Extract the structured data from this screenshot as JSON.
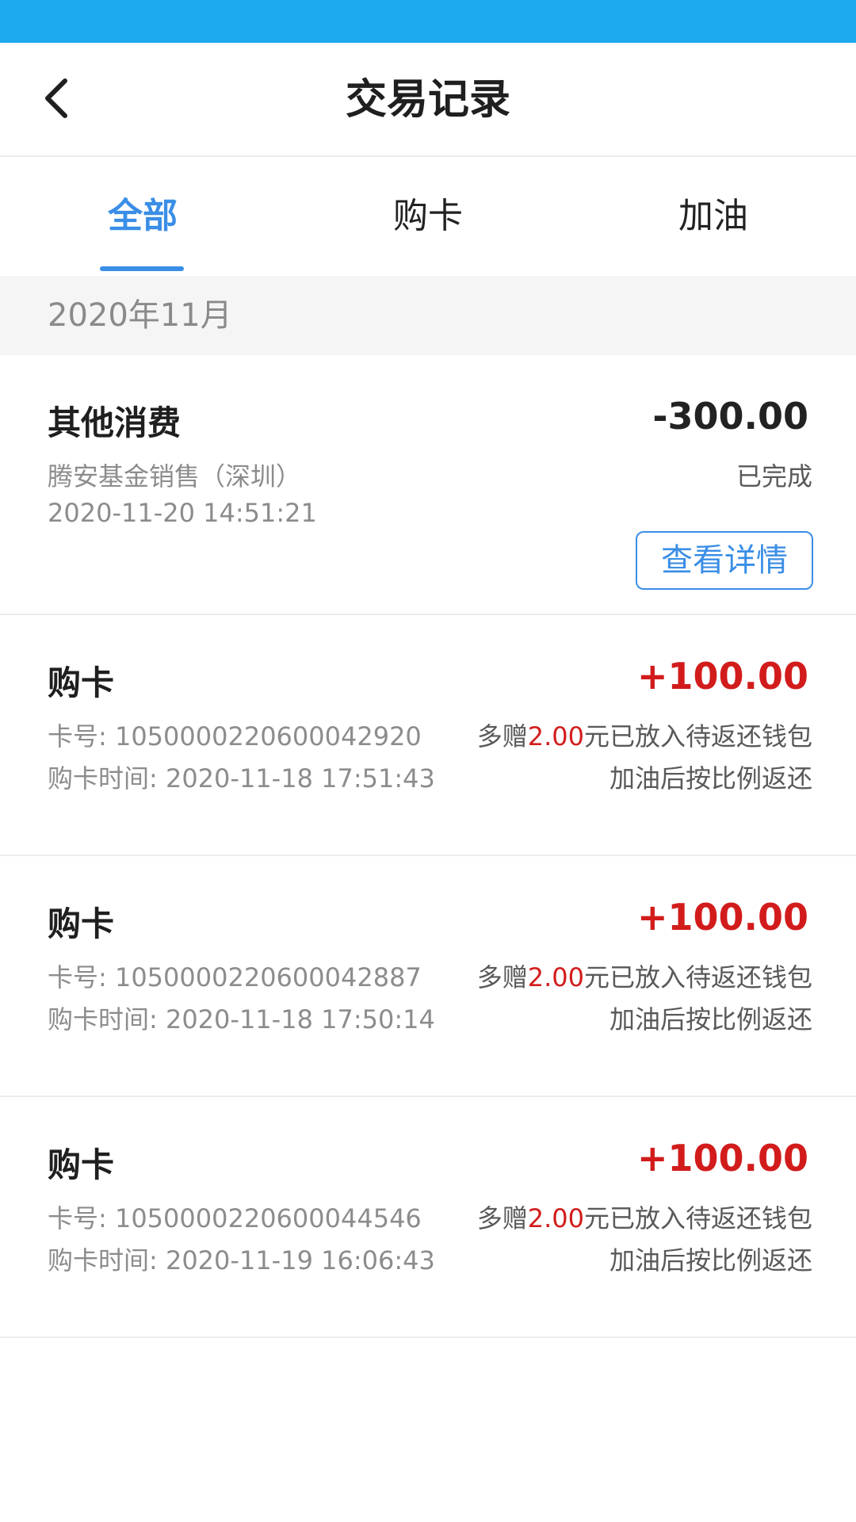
{
  "header": {
    "title": "交易记录",
    "back_icon": "chevron-left-icon"
  },
  "colors": {
    "status_bar": "#1da9ee",
    "accent": "#3a8ee6",
    "positive_amount": "#d21c1c"
  },
  "tabs": [
    {
      "label": "全部",
      "active": true
    },
    {
      "label": "购卡",
      "active": false
    },
    {
      "label": "加油",
      "active": false
    }
  ],
  "month": "2020年11月",
  "records": [
    {
      "title": "其他消费",
      "amount": "-300.00",
      "merchant": "腾安基金销售（深圳）",
      "time": "2020-11-20 14:51:21",
      "status": "已完成",
      "detail_button": "查看详情"
    },
    {
      "title": "购卡",
      "amount": "+100.00",
      "card_no": "卡号: 1050000220600042920",
      "purchase_time": "购卡时间: 2020-11-18 17:51:43",
      "bonus_prefix": "多赠",
      "bonus_value": "2.00",
      "bonus_suffix": "元已放入待返还钱包",
      "return_note": "加油后按比例返还"
    },
    {
      "title": "购卡",
      "amount": "+100.00",
      "card_no": "卡号: 1050000220600042887",
      "purchase_time": "购卡时间: 2020-11-18 17:50:14",
      "bonus_prefix": "多赠",
      "bonus_value": "2.00",
      "bonus_suffix": "元已放入待返还钱包",
      "return_note": "加油后按比例返还"
    },
    {
      "title": "购卡",
      "amount": "+100.00",
      "card_no": "卡号: 1050000220600044546",
      "purchase_time": "购卡时间: 2020-11-19 16:06:43",
      "bonus_prefix": "多赠",
      "bonus_value": "2.00",
      "bonus_suffix": "元已放入待返还钱包",
      "return_note": "加油后按比例返还"
    }
  ]
}
